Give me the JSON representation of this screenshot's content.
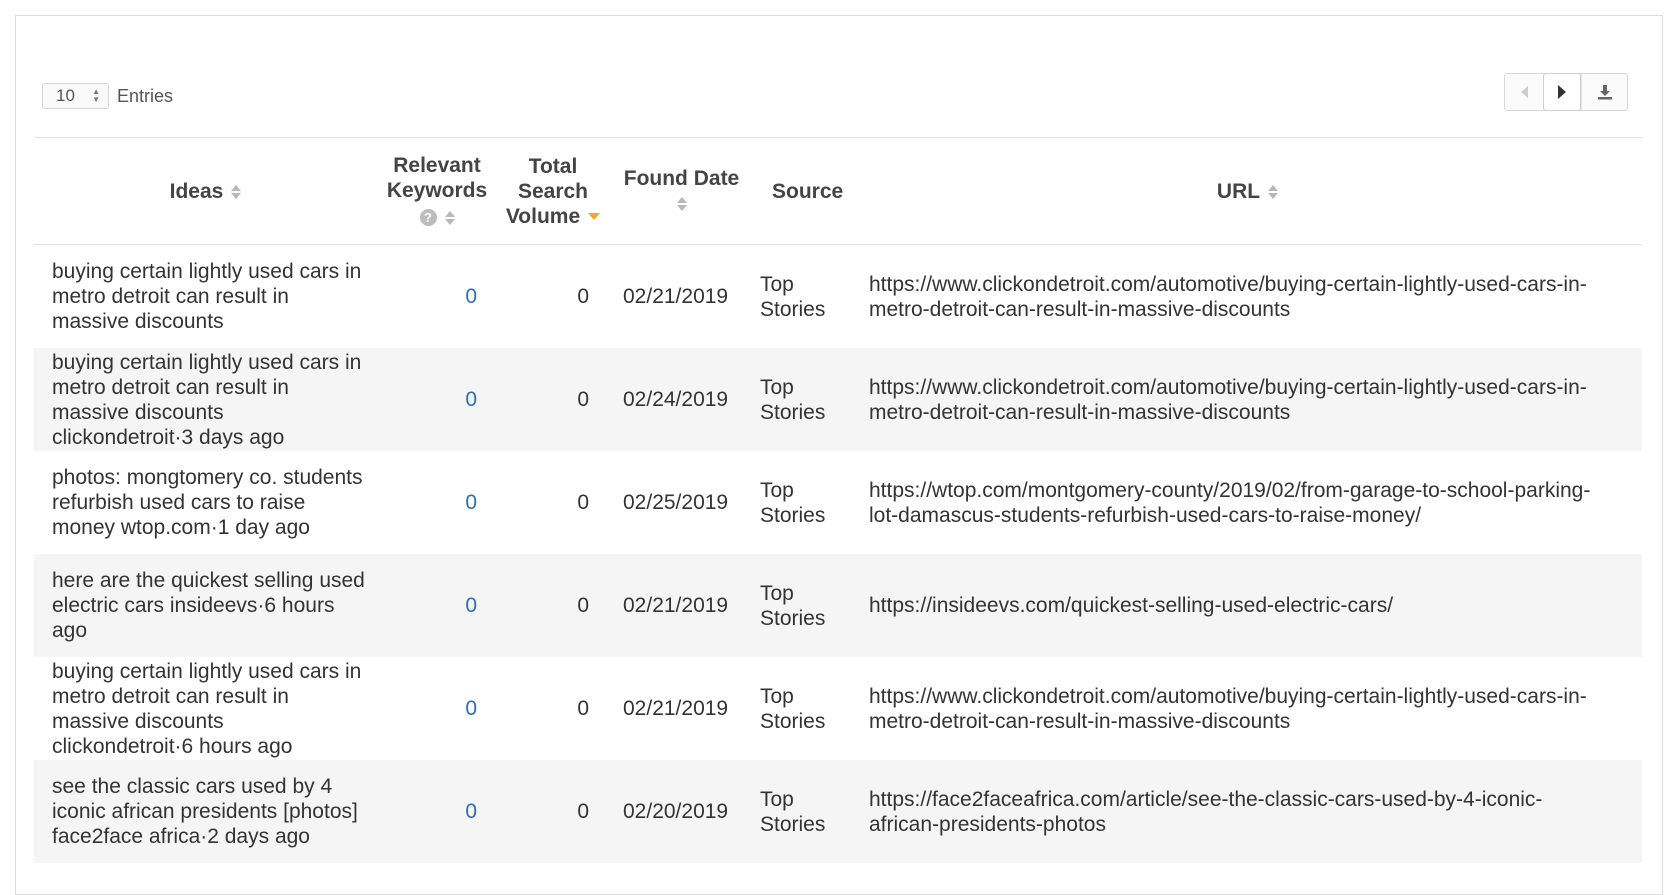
{
  "controls": {
    "entries_value": "10",
    "entries_label": "Entries"
  },
  "pager": {
    "prev_icon": "chevron-left-icon",
    "next_icon": "chevron-right-icon",
    "download_icon": "download-icon"
  },
  "table": {
    "headers": {
      "ideas": "Ideas",
      "relevant_keywords": "Relevant Keywords",
      "total_search_volume": "Total Search Volume",
      "found_date": "Found Date",
      "source": "Source",
      "url": "URL"
    },
    "sort": {
      "column": "Total Search Volume",
      "direction": "descending",
      "active_color": "#f5a623"
    },
    "link_color": "#2b6fb6",
    "rows": [
      {
        "idea": "buying certain lightly used cars in metro detroit can result in massive discounts",
        "keywords": "0",
        "volume": "0",
        "date": "02/21/2019",
        "source": "Top Stories",
        "url": "https://www.clickondetroit.com/automotive/buying-certain-lightly-used-cars-in-metro-detroit-can-result-in-massive-discounts"
      },
      {
        "idea": "buying certain lightly used cars in metro detroit can result in massive discounts clickondetroit·3 days ago",
        "keywords": "0",
        "volume": "0",
        "date": "02/24/2019",
        "source": "Top Stories",
        "url": "https://www.clickondetroit.com/automotive/buying-certain-lightly-used-cars-in-metro-detroit-can-result-in-massive-discounts"
      },
      {
        "idea": "photos: mongtomery co. students refurbish used cars to raise money wtop.com·1 day ago",
        "keywords": "0",
        "volume": "0",
        "date": "02/25/2019",
        "source": "Top Stories",
        "url": "https://wtop.com/montgomery-county/2019/02/from-garage-to-school-parking-lot-damascus-students-refurbish-used-cars-to-raise-money/"
      },
      {
        "idea": "here are the quickest selling used electric cars insideevs·6 hours ago",
        "keywords": "0",
        "volume": "0",
        "date": "02/21/2019",
        "source": "Top Stories",
        "url": "https://insideevs.com/quickest-selling-used-electric-cars/"
      },
      {
        "idea": "buying certain lightly used cars in metro detroit can result in massive discounts clickondetroit·6 hours ago",
        "keywords": "0",
        "volume": "0",
        "date": "02/21/2019",
        "source": "Top Stories",
        "url": "https://www.clickondetroit.com/automotive/buying-certain-lightly-used-cars-in-metro-detroit-can-result-in-massive-discounts"
      },
      {
        "idea": "see the classic cars used by 4 iconic african presidents [photos] face2face africa·2 days ago",
        "keywords": "0",
        "volume": "0",
        "date": "02/20/2019",
        "source": "Top Stories",
        "url": "https://face2faceafrica.com/article/see-the-classic-cars-used-by-4-iconic-african-presidents-photos"
      }
    ]
  }
}
